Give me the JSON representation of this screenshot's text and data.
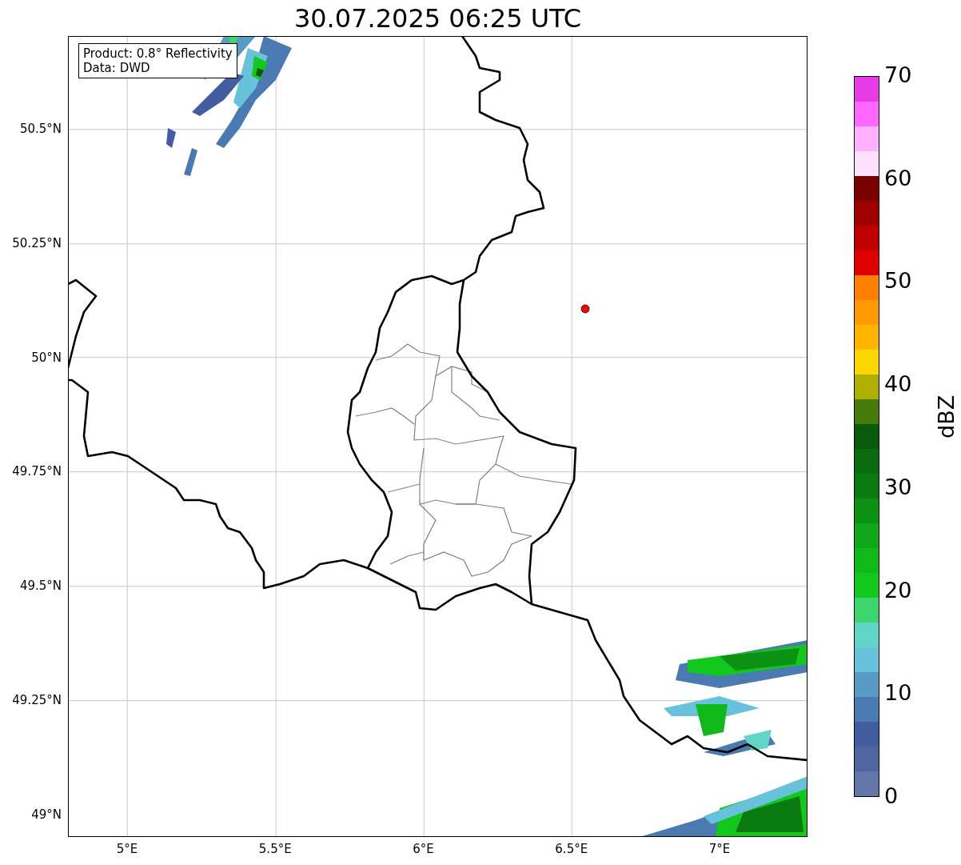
{
  "title": "30.07.2025 06:25 UTC",
  "legend": {
    "lines": [
      "Product: 0.8° Reflectivity",
      "Data: DWD"
    ]
  },
  "map": {
    "lat_ticks": [
      "50.5°N",
      "50.25°N",
      "50°N",
      "49.75°N",
      "49.5°N",
      "49.25°N",
      "49°N"
    ],
    "lon_ticks": [
      "5°E",
      "5.5°E",
      "6°E",
      "6.5°E",
      "7°E"
    ]
  },
  "colorbar": {
    "label": "dBZ",
    "ticks": [
      "70",
      "60",
      "50",
      "40",
      "30",
      "20",
      "10",
      "0"
    ],
    "bands": [
      {
        "color": "#6475a8"
      },
      {
        "color": "#50659f"
      },
      {
        "color": "#425ea0"
      },
      {
        "color": "#4a7ab0"
      },
      {
        "color": "#5a9bc5"
      },
      {
        "color": "#68c2dc"
      },
      {
        "color": "#62d6c6"
      },
      {
        "color": "#3dd66e"
      },
      {
        "color": "#12c81c"
      },
      {
        "color": "#10b81a"
      },
      {
        "color": "#0fa617"
      },
      {
        "color": "#0d9114"
      },
      {
        "color": "#0b7a10"
      },
      {
        "color": "#0a6c0e"
      },
      {
        "color": "#085a0a"
      },
      {
        "color": "#467a0b"
      },
      {
        "color": "#b0b000"
      },
      {
        "color": "#ffd700"
      },
      {
        "color": "#ffb400"
      },
      {
        "color": "#ff9a00"
      },
      {
        "color": "#ff7f00"
      },
      {
        "color": "#e00000"
      },
      {
        "color": "#c00000"
      },
      {
        "color": "#a00000"
      },
      {
        "color": "#780000"
      },
      {
        "color": "#ffe0ff"
      },
      {
        "color": "#ffb0ff"
      },
      {
        "color": "#ff66ff"
      },
      {
        "color": "#e83be8"
      }
    ]
  }
}
